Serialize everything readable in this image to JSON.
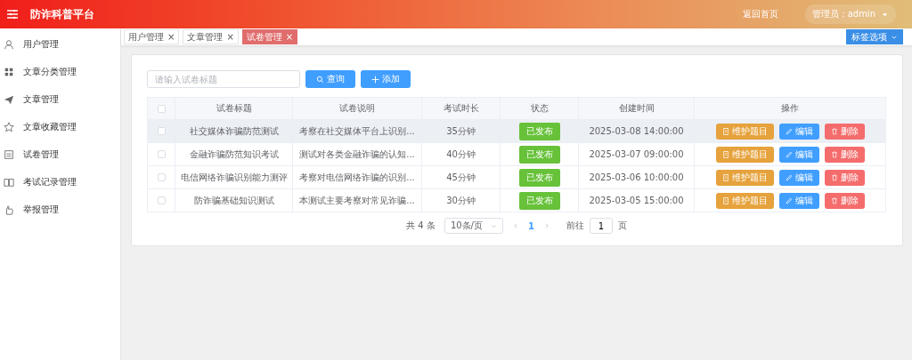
{
  "header": {
    "title": "防诈科普平台",
    "home_link": "返回首页",
    "user_menu": "管理员：admin"
  },
  "sidebar": {
    "items": [
      {
        "label": "用户管理",
        "selected": false
      },
      {
        "label": "文章分类管理",
        "selected": false
      },
      {
        "label": "文章管理",
        "selected": false
      },
      {
        "label": "文章收藏管理",
        "selected": false
      },
      {
        "label": "试卷管理",
        "selected": false
      },
      {
        "label": "考试记录管理",
        "selected": false
      },
      {
        "label": "举报管理",
        "selected": false
      }
    ]
  },
  "tabs": {
    "items": [
      {
        "label": "用户管理",
        "close": "×",
        "selected": false
      },
      {
        "label": "文章管理",
        "close": "×",
        "selected": false
      },
      {
        "label": "试卷管理",
        "close": "×",
        "selected": true
      }
    ],
    "options_button": "标签选项"
  },
  "toolbar": {
    "search": {
      "placeholder": "请输入试卷标题"
    },
    "query_button": "查询",
    "add_button": "添加"
  },
  "table": {
    "select_all_checked": false,
    "columns": [
      "试卷标题",
      "试卷说明",
      "考试时长",
      "状态",
      "创建时间",
      "操作"
    ],
    "rows": [
      {
        "checked": false,
        "hovered": true,
        "title": "社交媒体诈骗防范测试",
        "description": "考察在社交媒体平台上识别...",
        "duration": "35分钟",
        "status": "已发布",
        "created": "2025-03-08 14:00:00",
        "actions": [
          "维护题目",
          "编辑",
          "删除"
        ]
      },
      {
        "checked": false,
        "hovered": false,
        "title": "金融诈骗防范知识考试",
        "description": "测试对各类金融诈骗的认知...",
        "duration": "40分钟",
        "status": "已发布",
        "created": "2025-03-07 09:00:00",
        "actions": [
          "维护题目",
          "编辑",
          "删除"
        ]
      },
      {
        "checked": false,
        "hovered": false,
        "title": "电信网络诈骗识别能力测评",
        "description": "考察对电信网络诈骗的识别...",
        "duration": "45分钟",
        "status": "已发布",
        "created": "2025-03-06 10:00:00",
        "actions": [
          "维护题目",
          "编辑",
          "删除"
        ]
      },
      {
        "checked": false,
        "hovered": false,
        "title": "防诈骗基础知识测试",
        "description": "本测试主要考察对常见诈骗...",
        "duration": "30分钟",
        "status": "已发布",
        "created": "2025-03-05 15:00:00",
        "actions": [
          "维护题目",
          "编辑",
          "删除"
        ]
      }
    ]
  },
  "pagination": {
    "total": "共 4 条",
    "page_size": "10条/页",
    "pages": [
      {
        "label": "1",
        "selected": true
      }
    ],
    "goto_label": "前往",
    "goto_value": "1",
    "goto_suffix": "页"
  }
}
